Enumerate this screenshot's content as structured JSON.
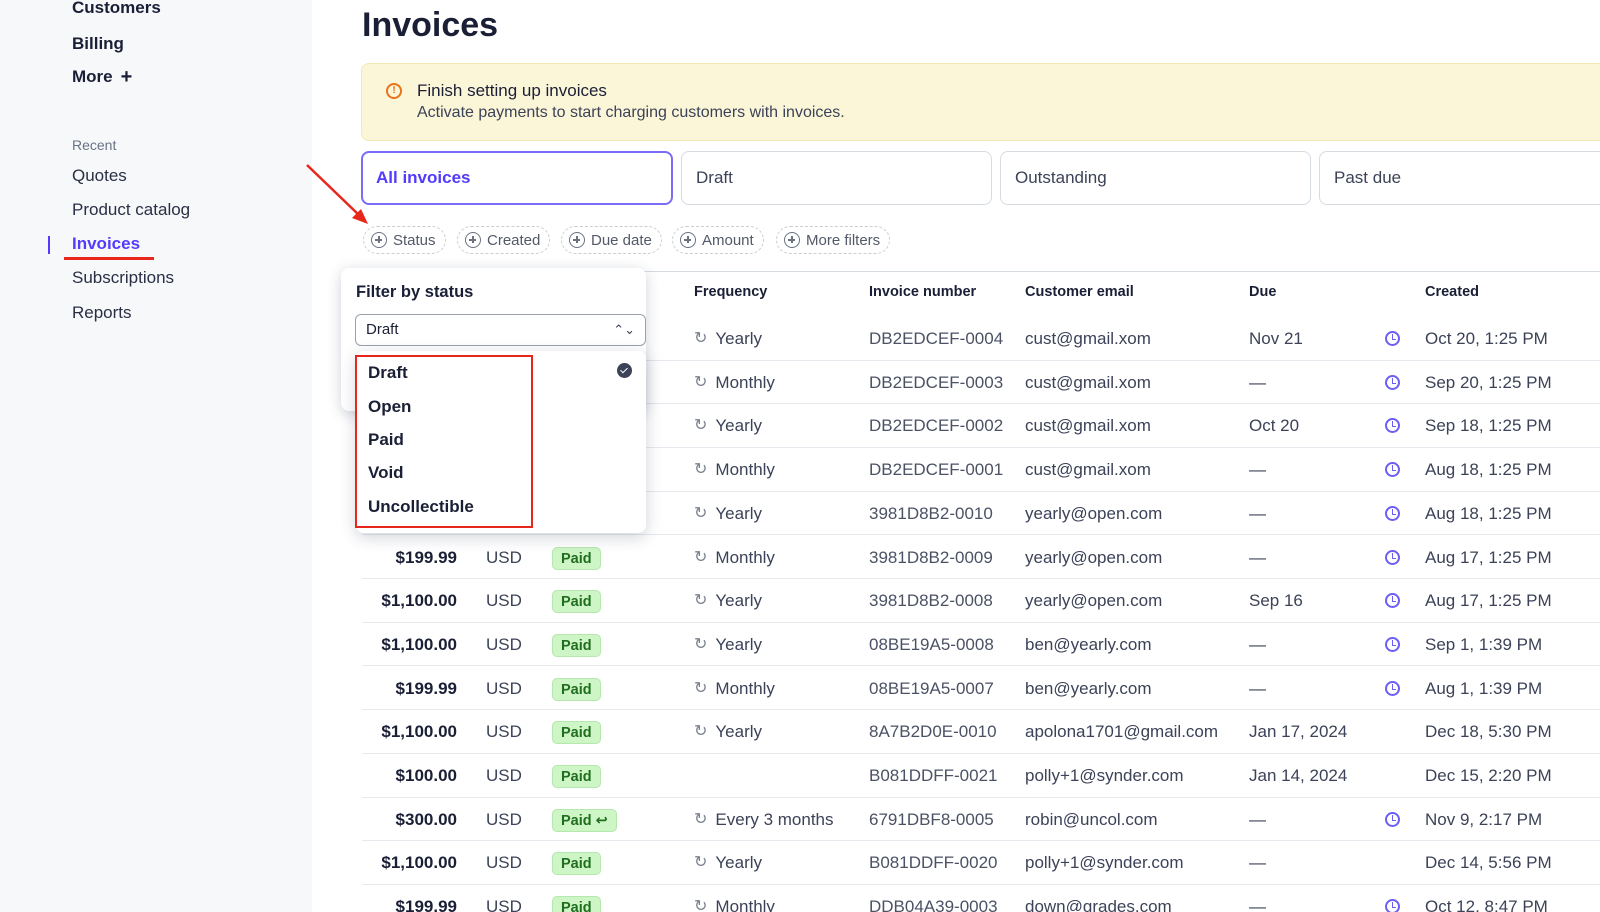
{
  "sidebar": {
    "items_top": [
      "Customers",
      "Billing"
    ],
    "more_label": "More",
    "recent_label": "Recent",
    "recent_items": [
      "Quotes",
      "Product catalog",
      "Invoices",
      "Subscriptions",
      "Reports"
    ],
    "active_item": "Invoices"
  },
  "page": {
    "title": "Invoices"
  },
  "banner": {
    "title": "Finish setting up invoices",
    "body": "Activate payments to start charging customers with invoices."
  },
  "tabs": [
    "All invoices",
    "Draft",
    "Outstanding",
    "Past due"
  ],
  "filters": [
    "Status",
    "Created",
    "Due date",
    "Amount",
    "More filters"
  ],
  "table": {
    "headers": {
      "frequency": "Frequency",
      "invoice_number": "Invoice number",
      "customer_email": "Customer email",
      "due": "Due",
      "created": "Created"
    },
    "rows": [
      {
        "amount": "",
        "currency": "",
        "status": "",
        "refund": false,
        "frequency": "Yearly",
        "invoice": "DB2EDCEF-0004",
        "email": "cust@gmail.xom",
        "due": "Nov 21",
        "clock": true,
        "created": "Oct 20, 1:25 PM"
      },
      {
        "amount": "",
        "currency": "",
        "status": "",
        "refund": false,
        "frequency": "Monthly",
        "invoice": "DB2EDCEF-0003",
        "email": "cust@gmail.xom",
        "due": "—",
        "clock": true,
        "created": "Sep 20, 1:25 PM"
      },
      {
        "amount": "",
        "currency": "",
        "status": "",
        "refund": false,
        "frequency": "Yearly",
        "invoice": "DB2EDCEF-0002",
        "email": "cust@gmail.xom",
        "due": "Oct 20",
        "clock": true,
        "created": "Sep 18, 1:25 PM"
      },
      {
        "amount": "",
        "currency": "",
        "status": "",
        "refund": false,
        "frequency": "Monthly",
        "invoice": "DB2EDCEF-0001",
        "email": "cust@gmail.xom",
        "due": "—",
        "clock": true,
        "created": "Aug 18, 1:25 PM"
      },
      {
        "amount": "",
        "currency": "",
        "status": "",
        "refund": false,
        "frequency": "Yearly",
        "invoice": "3981D8B2-0010",
        "email": "yearly@open.com",
        "due": "—",
        "clock": true,
        "created": "Aug 18, 1:25 PM"
      },
      {
        "amount": "$199.99",
        "currency": "USD",
        "status": "Paid",
        "refund": false,
        "frequency": "Monthly",
        "invoice": "3981D8B2-0009",
        "email": "yearly@open.com",
        "due": "—",
        "clock": true,
        "created": "Aug 17, 1:25 PM"
      },
      {
        "amount": "$1,100.00",
        "currency": "USD",
        "status": "Paid",
        "refund": false,
        "frequency": "Yearly",
        "invoice": "3981D8B2-0008",
        "email": "yearly@open.com",
        "due": "Sep 16",
        "clock": true,
        "created": "Aug 17, 1:25 PM"
      },
      {
        "amount": "$1,100.00",
        "currency": "USD",
        "status": "Paid",
        "refund": false,
        "frequency": "Yearly",
        "invoice": "08BE19A5-0008",
        "email": "ben@yearly.com",
        "due": "—",
        "clock": true,
        "created": "Sep 1, 1:39 PM"
      },
      {
        "amount": "$199.99",
        "currency": "USD",
        "status": "Paid",
        "refund": false,
        "frequency": "Monthly",
        "invoice": "08BE19A5-0007",
        "email": "ben@yearly.com",
        "due": "—",
        "clock": true,
        "created": "Aug 1, 1:39 PM"
      },
      {
        "amount": "$1,100.00",
        "currency": "USD",
        "status": "Paid",
        "refund": false,
        "frequency": "Yearly",
        "invoice": "8A7B2D0E-0010",
        "email": "apolona1701@gmail.com",
        "due": "Jan 17, 2024",
        "clock": false,
        "created": "Dec 18, 5:30 PM"
      },
      {
        "amount": "$100.00",
        "currency": "USD",
        "status": "Paid",
        "refund": false,
        "frequency": "",
        "invoice": "B081DDFF-0021",
        "email": "polly+1@synder.com",
        "due": "Jan 14, 2024",
        "clock": false,
        "created": "Dec 15, 2:20 PM"
      },
      {
        "amount": "$300.00",
        "currency": "USD",
        "status": "Paid",
        "refund": true,
        "frequency": "Every 3 months",
        "invoice": "6791DBF8-0005",
        "email": "robin@uncol.com",
        "due": "—",
        "clock": true,
        "created": "Nov 9, 2:17 PM"
      },
      {
        "amount": "$1,100.00",
        "currency": "USD",
        "status": "Paid",
        "refund": false,
        "frequency": "Yearly",
        "invoice": "B081DDFF-0020",
        "email": "polly+1@synder.com",
        "due": "—",
        "clock": false,
        "created": "Dec 14, 5:56 PM"
      },
      {
        "amount": "$199.99",
        "currency": "USD",
        "status": "Paid",
        "refund": false,
        "frequency": "Monthly",
        "invoice": "DDB04A39-0003",
        "email": "down@grades.com",
        "due": "—",
        "clock": true,
        "created": "Oct 12, 8:47 PM"
      }
    ]
  },
  "status_filter": {
    "title": "Filter by status",
    "selected": "Draft",
    "options": [
      "Draft",
      "Open",
      "Paid",
      "Void",
      "Uncollectible"
    ]
  },
  "colors": {
    "accent": "#533afd",
    "annotation": "#e8261b",
    "banner_bg": "#fcf6d9",
    "paid_bg": "#cdf5c6"
  }
}
